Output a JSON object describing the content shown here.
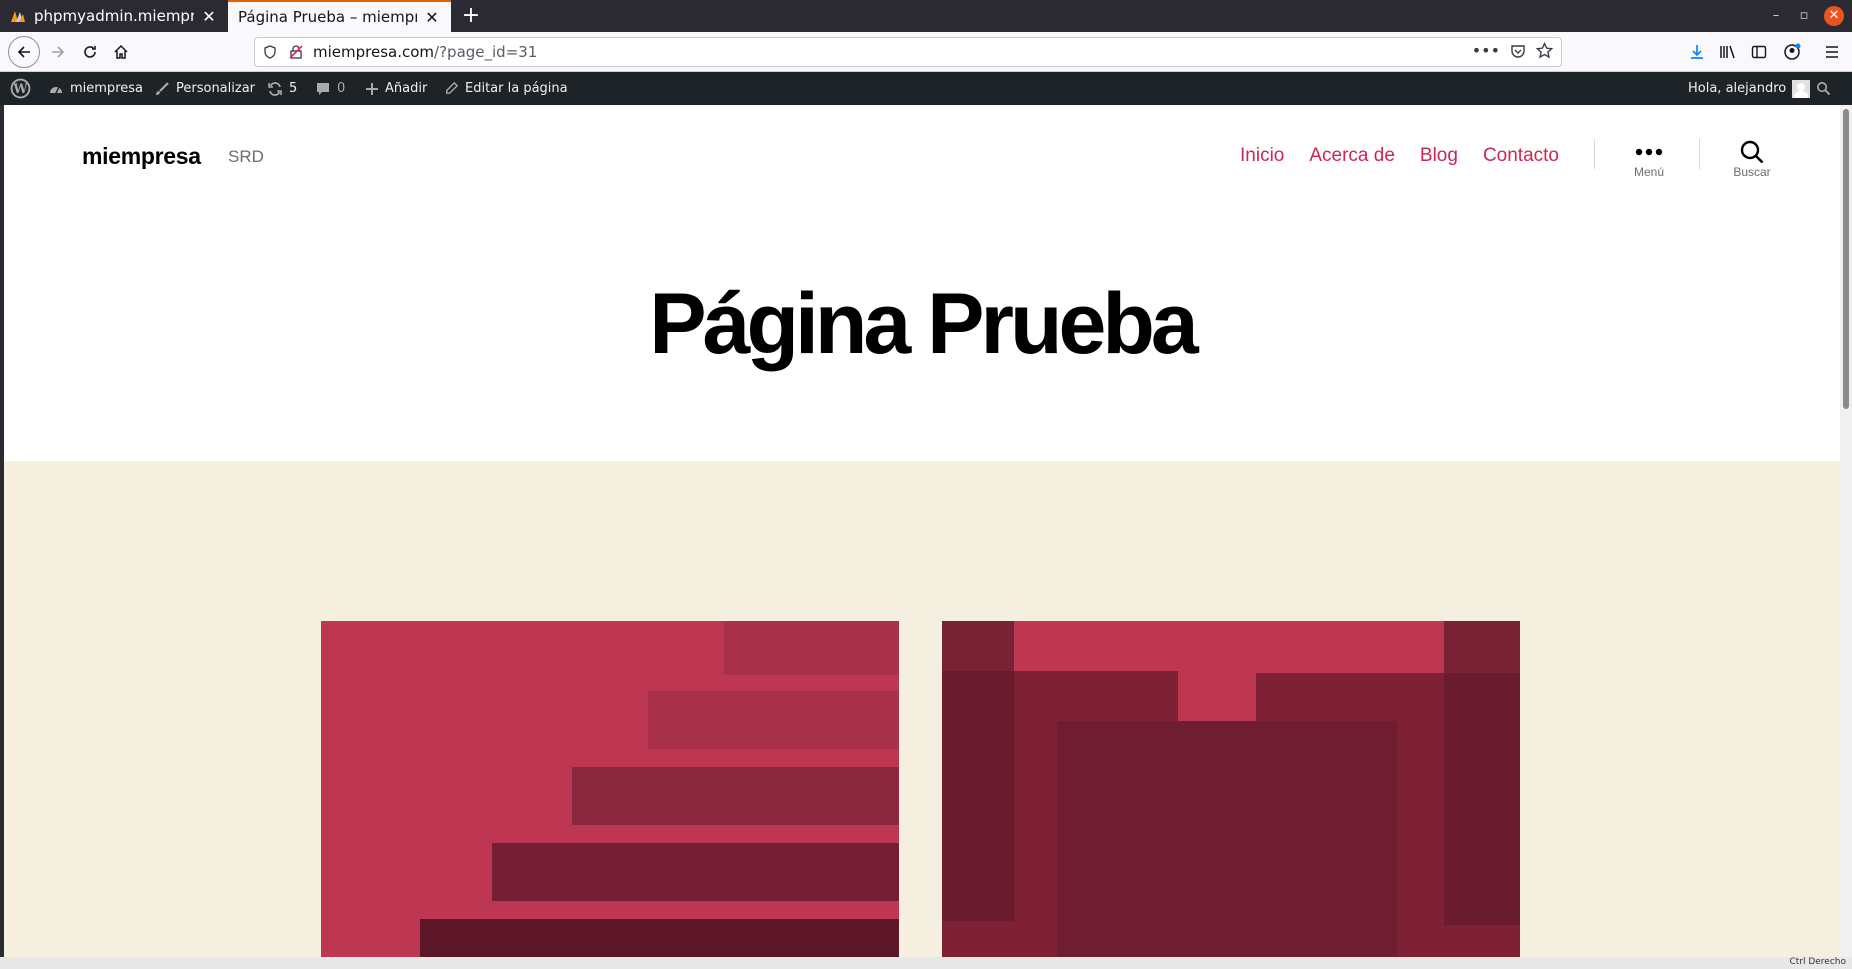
{
  "browser": {
    "tabs": [
      {
        "title": "phpmyadmin.miempresa",
        "active": false
      },
      {
        "title": "Página Prueba – miempresa",
        "active": true
      }
    ],
    "url_domain": "miempresa.com",
    "url_path": "/?page_id=31"
  },
  "adminbar": {
    "site_name": "miempresa",
    "customize": "Personalizar",
    "updates_count": "5",
    "comments_count": "0",
    "add_new": "Añadir",
    "edit_page": "Editar la página",
    "greeting": "Hola, alejandro"
  },
  "site": {
    "title": "miempresa",
    "description": "SRD"
  },
  "nav": {
    "items": [
      "Inicio",
      "Acerca de",
      "Blog",
      "Contacto"
    ],
    "menu_label": "Menú",
    "search_label": "Buscar"
  },
  "page": {
    "title": "Página Prueba"
  },
  "os_tray": {
    "text": "Ctrl Derecho"
  },
  "colors": {
    "accent": "#cd2653",
    "content_background": "#f5efe0",
    "admin_bar": "#1d2327",
    "art_base": "#bd3753"
  }
}
